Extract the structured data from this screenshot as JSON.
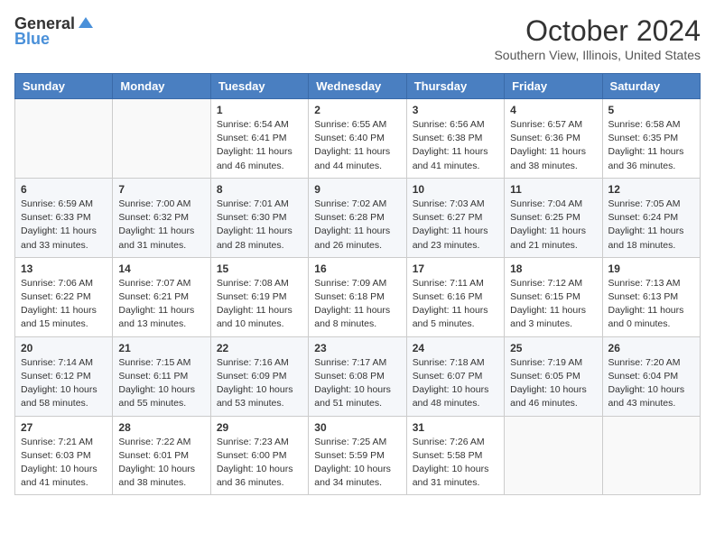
{
  "header": {
    "logo_general": "General",
    "logo_blue": "Blue",
    "month": "October 2024",
    "location": "Southern View, Illinois, United States"
  },
  "weekdays": [
    "Sunday",
    "Monday",
    "Tuesday",
    "Wednesday",
    "Thursday",
    "Friday",
    "Saturday"
  ],
  "weeks": [
    [
      {
        "day": "",
        "info": ""
      },
      {
        "day": "",
        "info": ""
      },
      {
        "day": "1",
        "info": "Sunrise: 6:54 AM\nSunset: 6:41 PM\nDaylight: 11 hours and 46 minutes."
      },
      {
        "day": "2",
        "info": "Sunrise: 6:55 AM\nSunset: 6:40 PM\nDaylight: 11 hours and 44 minutes."
      },
      {
        "day": "3",
        "info": "Sunrise: 6:56 AM\nSunset: 6:38 PM\nDaylight: 11 hours and 41 minutes."
      },
      {
        "day": "4",
        "info": "Sunrise: 6:57 AM\nSunset: 6:36 PM\nDaylight: 11 hours and 38 minutes."
      },
      {
        "day": "5",
        "info": "Sunrise: 6:58 AM\nSunset: 6:35 PM\nDaylight: 11 hours and 36 minutes."
      }
    ],
    [
      {
        "day": "6",
        "info": "Sunrise: 6:59 AM\nSunset: 6:33 PM\nDaylight: 11 hours and 33 minutes."
      },
      {
        "day": "7",
        "info": "Sunrise: 7:00 AM\nSunset: 6:32 PM\nDaylight: 11 hours and 31 minutes."
      },
      {
        "day": "8",
        "info": "Sunrise: 7:01 AM\nSunset: 6:30 PM\nDaylight: 11 hours and 28 minutes."
      },
      {
        "day": "9",
        "info": "Sunrise: 7:02 AM\nSunset: 6:28 PM\nDaylight: 11 hours and 26 minutes."
      },
      {
        "day": "10",
        "info": "Sunrise: 7:03 AM\nSunset: 6:27 PM\nDaylight: 11 hours and 23 minutes."
      },
      {
        "day": "11",
        "info": "Sunrise: 7:04 AM\nSunset: 6:25 PM\nDaylight: 11 hours and 21 minutes."
      },
      {
        "day": "12",
        "info": "Sunrise: 7:05 AM\nSunset: 6:24 PM\nDaylight: 11 hours and 18 minutes."
      }
    ],
    [
      {
        "day": "13",
        "info": "Sunrise: 7:06 AM\nSunset: 6:22 PM\nDaylight: 11 hours and 15 minutes."
      },
      {
        "day": "14",
        "info": "Sunrise: 7:07 AM\nSunset: 6:21 PM\nDaylight: 11 hours and 13 minutes."
      },
      {
        "day": "15",
        "info": "Sunrise: 7:08 AM\nSunset: 6:19 PM\nDaylight: 11 hours and 10 minutes."
      },
      {
        "day": "16",
        "info": "Sunrise: 7:09 AM\nSunset: 6:18 PM\nDaylight: 11 hours and 8 minutes."
      },
      {
        "day": "17",
        "info": "Sunrise: 7:11 AM\nSunset: 6:16 PM\nDaylight: 11 hours and 5 minutes."
      },
      {
        "day": "18",
        "info": "Sunrise: 7:12 AM\nSunset: 6:15 PM\nDaylight: 11 hours and 3 minutes."
      },
      {
        "day": "19",
        "info": "Sunrise: 7:13 AM\nSunset: 6:13 PM\nDaylight: 11 hours and 0 minutes."
      }
    ],
    [
      {
        "day": "20",
        "info": "Sunrise: 7:14 AM\nSunset: 6:12 PM\nDaylight: 10 hours and 58 minutes."
      },
      {
        "day": "21",
        "info": "Sunrise: 7:15 AM\nSunset: 6:11 PM\nDaylight: 10 hours and 55 minutes."
      },
      {
        "day": "22",
        "info": "Sunrise: 7:16 AM\nSunset: 6:09 PM\nDaylight: 10 hours and 53 minutes."
      },
      {
        "day": "23",
        "info": "Sunrise: 7:17 AM\nSunset: 6:08 PM\nDaylight: 10 hours and 51 minutes."
      },
      {
        "day": "24",
        "info": "Sunrise: 7:18 AM\nSunset: 6:07 PM\nDaylight: 10 hours and 48 minutes."
      },
      {
        "day": "25",
        "info": "Sunrise: 7:19 AM\nSunset: 6:05 PM\nDaylight: 10 hours and 46 minutes."
      },
      {
        "day": "26",
        "info": "Sunrise: 7:20 AM\nSunset: 6:04 PM\nDaylight: 10 hours and 43 minutes."
      }
    ],
    [
      {
        "day": "27",
        "info": "Sunrise: 7:21 AM\nSunset: 6:03 PM\nDaylight: 10 hours and 41 minutes."
      },
      {
        "day": "28",
        "info": "Sunrise: 7:22 AM\nSunset: 6:01 PM\nDaylight: 10 hours and 38 minutes."
      },
      {
        "day": "29",
        "info": "Sunrise: 7:23 AM\nSunset: 6:00 PM\nDaylight: 10 hours and 36 minutes."
      },
      {
        "day": "30",
        "info": "Sunrise: 7:25 AM\nSunset: 5:59 PM\nDaylight: 10 hours and 34 minutes."
      },
      {
        "day": "31",
        "info": "Sunrise: 7:26 AM\nSunset: 5:58 PM\nDaylight: 10 hours and 31 minutes."
      },
      {
        "day": "",
        "info": ""
      },
      {
        "day": "",
        "info": ""
      }
    ]
  ]
}
